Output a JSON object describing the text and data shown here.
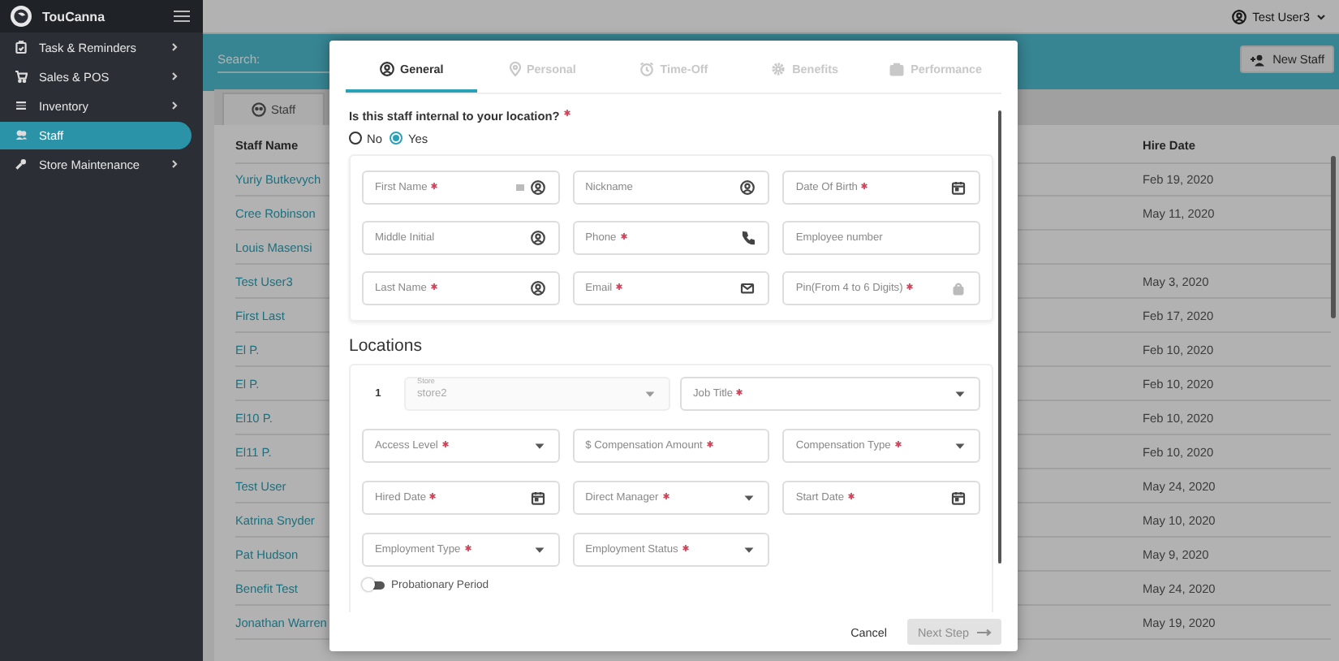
{
  "sidebar": {
    "brand": "TouCanna",
    "items": [
      {
        "label": "Task & Reminders",
        "selected": false,
        "has_submenu": true
      },
      {
        "label": "Sales & POS",
        "selected": false,
        "has_submenu": true
      },
      {
        "label": "Inventory",
        "selected": false,
        "has_submenu": true
      },
      {
        "label": "Staff",
        "selected": true,
        "has_submenu": false
      },
      {
        "label": "Store Maintenance",
        "selected": false,
        "has_submenu": true
      }
    ]
  },
  "topbar": {
    "user": "Test User3"
  },
  "toolbar": {
    "search_label": "Search:",
    "new_button": "New Staff"
  },
  "page_tabs": [
    {
      "label": "Staff",
      "selected": true
    }
  ],
  "table": {
    "columns": [
      "Staff Name",
      "Hire Date"
    ],
    "rows": [
      {
        "name": "Yuriy Butkevych",
        "hire_date": "Feb 19, 2020"
      },
      {
        "name": "Cree Robinson",
        "hire_date": "May 11, 2020"
      },
      {
        "name": "Louis Masensi"
      },
      {
        "name": "Test User3",
        "hire_date": "May 3, 2020"
      },
      {
        "name": "First Last",
        "hire_date": "Feb 17, 2020"
      },
      {
        "name": "El P.",
        "hire_date": "Feb 10, 2020"
      },
      {
        "name": "El P.",
        "hire_date": "Feb 10, 2020"
      },
      {
        "name": "El10 P.",
        "hire_date": "Feb 10, 2020"
      },
      {
        "name": "El11 P.",
        "hire_date": "Feb 10, 2020"
      },
      {
        "name": "Test User",
        "hire_date": "May 24, 2020"
      },
      {
        "name": "Katrina Snyder",
        "hire_date": "May 10, 2020"
      },
      {
        "name": "Pat Hudson",
        "hire_date": "May 9, 2020"
      },
      {
        "name": "Benefit Test",
        "hire_date": "May 24, 2020"
      },
      {
        "name": "Jonathan Warren",
        "hire_date": "May 19, 2020"
      }
    ]
  },
  "modal": {
    "tabs": [
      {
        "label": "General",
        "selected": true
      },
      {
        "label": "Personal",
        "selected": false
      },
      {
        "label": "Time-Off",
        "selected": false
      },
      {
        "label": "Benefits",
        "selected": false
      },
      {
        "label": "Performance",
        "selected": false
      }
    ],
    "question": {
      "text": "Is this staff internal to your location?",
      "required": true,
      "options": [
        {
          "label": "No",
          "selected": false
        },
        {
          "label": "Yes",
          "selected": true
        }
      ]
    },
    "fields": [
      {
        "label": "First Name",
        "required": true,
        "kind": "name"
      },
      {
        "label": "Nickname",
        "required": false,
        "kind": "name"
      },
      {
        "label": "Date Of Birth",
        "required": true,
        "kind": "date"
      },
      {
        "label": "Middle Initial",
        "required": false,
        "kind": "name"
      },
      {
        "label": "Phone",
        "required": true,
        "kind": "phone"
      },
      {
        "label": "Employee number",
        "required": false,
        "kind": "text"
      },
      {
        "label": "Last Name",
        "required": true,
        "kind": "name"
      },
      {
        "label": "Email",
        "required": true,
        "kind": "email"
      },
      {
        "label": "Pin(From 4 to 6 Digits)",
        "required": true,
        "kind": "pin"
      }
    ],
    "locations": {
      "title": "Locations",
      "index": "1",
      "store": {
        "label": "Store",
        "value": "store2",
        "disabled": true
      },
      "fields": [
        {
          "label": "Job Title",
          "required": true,
          "kind": "select"
        },
        {
          "label": "Access Level",
          "required": true,
          "kind": "select"
        },
        {
          "label": "Compensation Amount",
          "required": true,
          "kind": "money",
          "prefix": "$"
        },
        {
          "label": "Compensation Type",
          "required": true,
          "kind": "select"
        },
        {
          "label": "Hired Date",
          "required": true,
          "kind": "date"
        },
        {
          "label": "Direct Manager",
          "required": true,
          "kind": "select"
        },
        {
          "label": "Start Date",
          "required": true,
          "kind": "date"
        },
        {
          "label": "Employment Type",
          "required": true,
          "kind": "select"
        },
        {
          "label": "Employment Status",
          "required": true,
          "kind": "select"
        }
      ],
      "toggle": {
        "label": "Probationary Period",
        "on": false
      }
    },
    "cancel": "Cancel",
    "next": {
      "label": "Next Step",
      "disabled": true
    }
  }
}
